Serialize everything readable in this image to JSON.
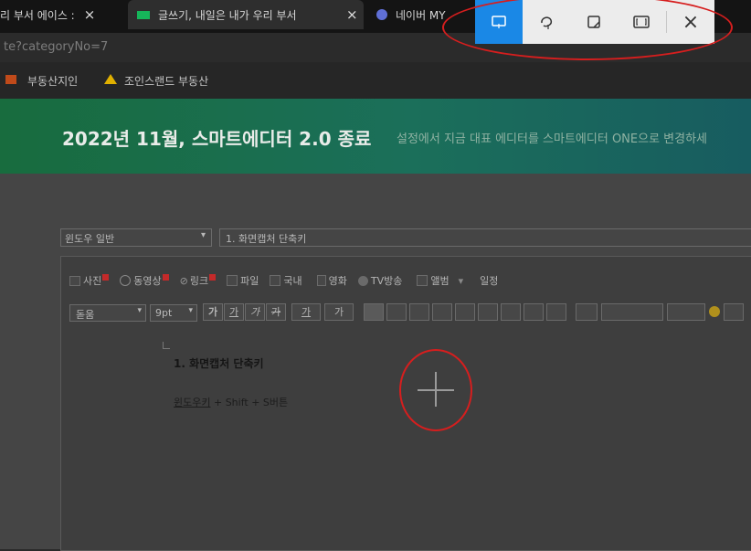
{
  "browser": {
    "tabs": [
      {
        "title": "리 부서 에이스 :",
        "close": "×"
      },
      {
        "title": "글쓰기, 내일은 내가 우리 부서",
        "close": "×"
      },
      {
        "title": "네이버 MY"
      }
    ],
    "address": "te?categoryNo=7",
    "bookmarks": [
      "부동산지인",
      "조인스랜드 부동산"
    ]
  },
  "banner": {
    "title": "2022년 11월, 스마트에디터 2.0 종료",
    "subtitle": "설정에서 지금 대표 에디터를 스마트에디터 ONE으로 변경하세"
  },
  "editor": {
    "category_select": "윈도우 일반",
    "title_input": "1. 화면캡처 단축키",
    "insert_toolbar": [
      "사진",
      "동영상",
      "링크",
      "파일",
      "국내",
      "영화",
      "TV방송",
      "앨범",
      "일정"
    ],
    "format_toolbar": {
      "font": "돋움",
      "size": "9pt",
      "style_buttons": [
        "가",
        "가",
        "가",
        "가",
        "가",
        "가"
      ]
    },
    "body": {
      "heading": "1. 화면캡처 단축키",
      "shortcut_link": "윈도우키",
      "shortcut_rest": " + Shift + S버튼"
    }
  },
  "snip_toolbar": {
    "close": "×",
    "accent": "#1a88e6"
  },
  "colors": {
    "annotation_circle": "#d61e1e"
  }
}
